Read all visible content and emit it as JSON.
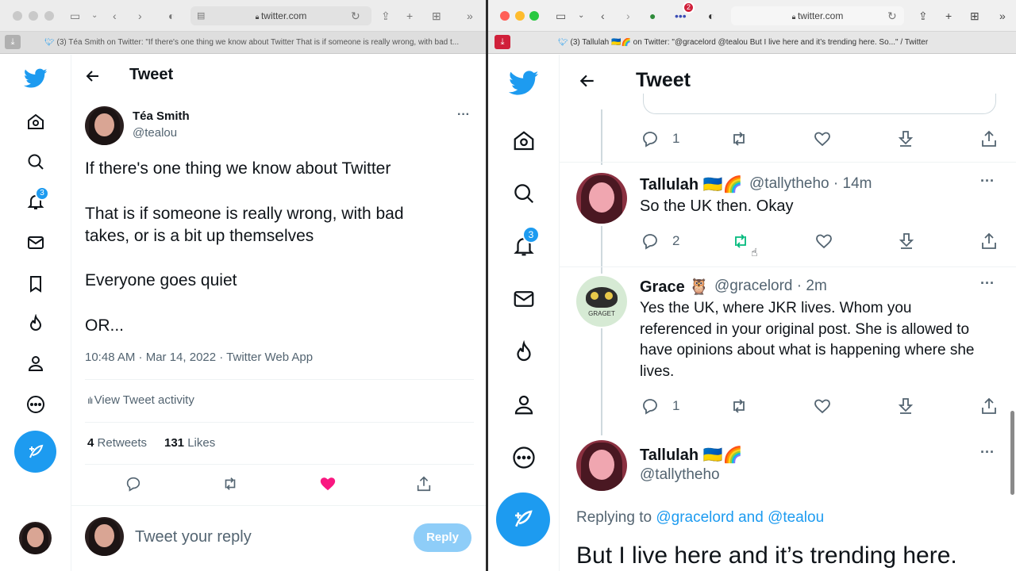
{
  "left": {
    "address": "twitter.com",
    "tab_title": "(3) Téa Smith on Twitter: \"If there's one thing we know about Twitter That is if someone is really wrong, with bad t...",
    "notif_count": "3",
    "header_title": "Tweet",
    "author_name": "Téa Smith",
    "author_handle": "@tealou",
    "more": "···",
    "tweet_lines": [
      "If there's one thing we know about Twitter",
      "That is if someone is really wrong, with bad",
      "takes, or is a bit up themselves",
      "Everyone goes quiet",
      "OR..."
    ],
    "timestamp": "10:48 AM · Mar 14, 2022 · Twitter Web App",
    "activity_label": "View Tweet activity",
    "retweets_count": "4",
    "retweets_label": "Retweets",
    "likes_count": "131",
    "likes_label": "Likes",
    "reply_placeholder": "Tweet your reply",
    "reply_button": "Reply"
  },
  "right": {
    "address": "twitter.com",
    "ext_badge": "2",
    "tab_title": "(3) Tallulah 🇺🇦🌈 on Twitter: \"@gracelord @tealou But I live here and it’s trending here. So...\" / Twitter",
    "notif_count": "3",
    "header_title": "Tweet",
    "top_reply_count": "1",
    "reply1": {
      "name": "Tallulah 🇺🇦🌈",
      "meta": "@tallytheho · 14m",
      "text": "So the UK then. Okay",
      "reply_count": "2",
      "more": "···"
    },
    "reply2": {
      "name": "Grace 🦉",
      "meta": "@gracelord · 2m",
      "lines": [
        "Yes the UK, where JKR lives. Whom you",
        "referenced in your original post. She is allowed to",
        "have opinions about what is happening where she",
        "lives."
      ],
      "reply_count": "1",
      "more": "···",
      "avatar_text": "GRAGET"
    },
    "main": {
      "name": "Tallulah 🇺🇦🌈",
      "handle": "@tallytheho",
      "replying_prefix": "Replying to",
      "replying_to": "@gracelord and @tealou",
      "text": "But I live here and it’s trending here.",
      "more": "···"
    }
  },
  "colors": {
    "twitter_blue": "#1d9bf0",
    "like_pink": "#f91880",
    "text_primary": "#0f1419",
    "text_secondary": "#536471"
  }
}
